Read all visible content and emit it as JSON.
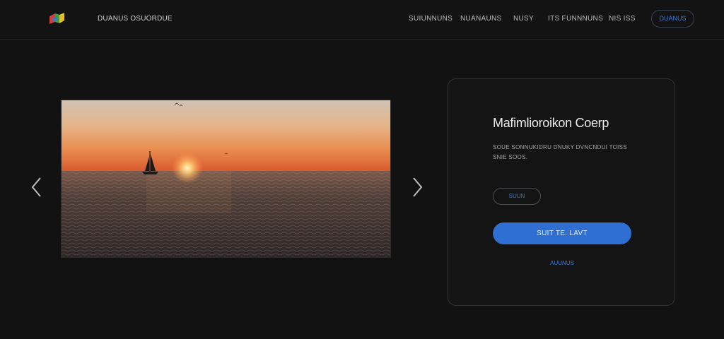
{
  "header": {
    "brand": "DUANUS OSUORDUE",
    "nav_items": [
      "SUIUNNUNS",
      "NUANAUNS",
      "NUSY",
      "ITS FUNNNUNS",
      "NIS ISS"
    ],
    "nav_button": "DUANUS"
  },
  "carousel": {
    "prev_label": "previous",
    "next_label": "next",
    "image_alt": "sunset over the sea with a sailboat"
  },
  "card": {
    "title": "Mafimlioroikon Coerp",
    "description_line1": "SOUE SONNUKIDRU DNUKY DVNCNDUI TOISS",
    "description_line2": "SNIE SOOS.",
    "pill_label": "SUUN",
    "cta_label": "SUIT TE. LAVT",
    "link_label": "AUUNUS"
  },
  "colors": {
    "background": "#121212",
    "accent": "#2f6fd1",
    "link": "#3e7bd6"
  },
  "icons": {
    "logo": "colorful-cube-logo",
    "prev": "chevron-left-icon",
    "next": "chevron-right-icon"
  }
}
